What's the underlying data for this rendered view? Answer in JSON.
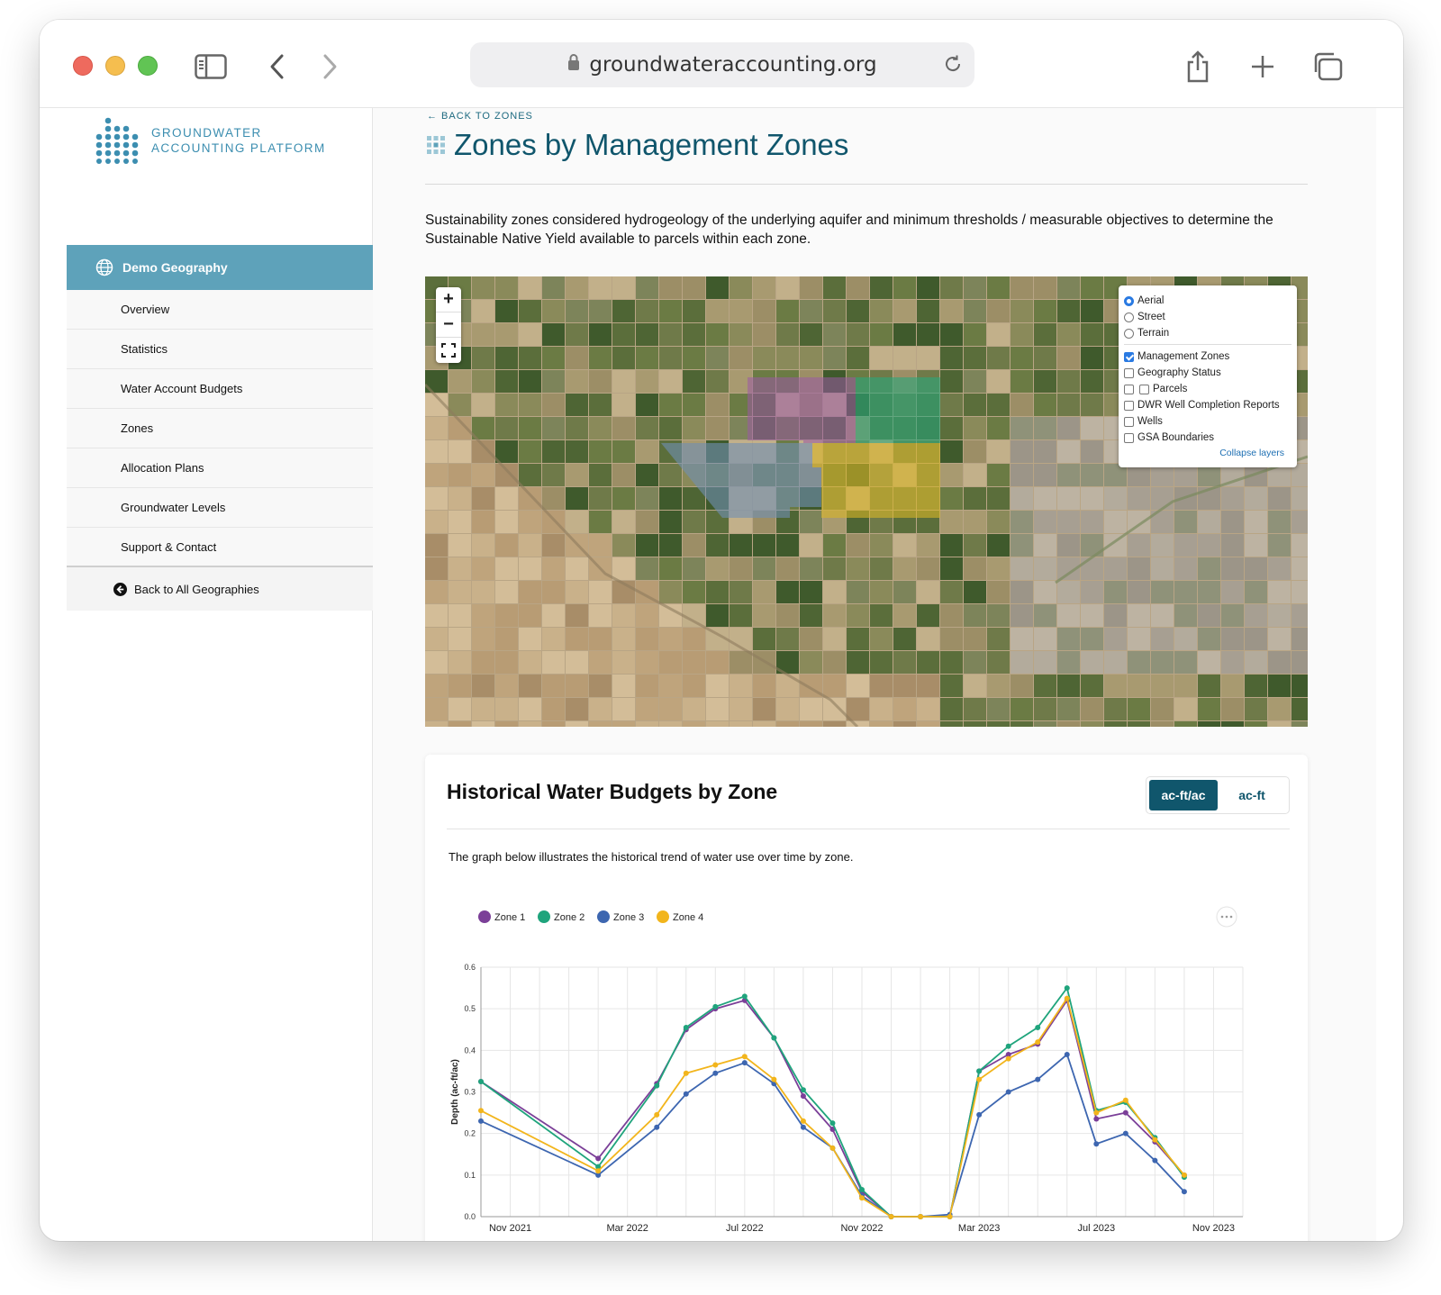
{
  "browser": {
    "url": "groundwateraccounting.org"
  },
  "sidebar": {
    "logo_line1": "GROUNDWATER",
    "logo_line2": "ACCOUNTING PLATFORM",
    "active_item": "Demo Geography",
    "items": [
      {
        "label": "Overview"
      },
      {
        "label": "Statistics"
      },
      {
        "label": "Water Account Budgets"
      },
      {
        "label": "Zones"
      },
      {
        "label": "Allocation Plans"
      },
      {
        "label": "Groundwater Levels"
      },
      {
        "label": "Support & Contact"
      }
    ],
    "back_label": "Back to All Geographies"
  },
  "main": {
    "back_link": "← BACK TO ZONES",
    "title": "Zones by Management Zones",
    "description": "Sustainability zones considered hydrogeology of the underlying aquifer and minimum thresholds / measurable objectives to determine the Sustainable Native Yield available to parcels within each zone."
  },
  "map": {
    "zoom_in": "+",
    "zoom_out": "−",
    "base_layers": [
      {
        "label": "Aerial",
        "selected": true
      },
      {
        "label": "Street",
        "selected": false
      },
      {
        "label": "Terrain",
        "selected": false
      }
    ],
    "overlays": [
      {
        "label": "Management Zones",
        "checked": true
      },
      {
        "label": "Geography Status",
        "checked": false
      },
      {
        "label": "Parcels",
        "checked": false
      },
      {
        "label": "DWR Well Completion Reports",
        "checked": false
      },
      {
        "label": "Wells",
        "checked": false
      },
      {
        "label": "GSA Boundaries",
        "checked": false
      }
    ],
    "collapse_label": "Collapse layers",
    "zone_colors": {
      "zone1": "#9a5aa6",
      "zone2": "#2aa77c",
      "zone3": "#6f8fb4",
      "zone4": "#d9b526"
    }
  },
  "budget_card": {
    "title": "Historical Water Budgets by Zone",
    "unit_active": "ac-ft/ac",
    "unit_other": "ac-ft",
    "description": "The graph below illustrates the historical trend of water use over time by zone."
  },
  "chart_data": {
    "type": "line",
    "ylabel": "Depth (ac-ft/ac)",
    "ylim": [
      0,
      0.6
    ],
    "yticks": [
      "0.0",
      "0.1",
      "0.2",
      "0.3",
      "0.4",
      "0.5",
      "0.6"
    ],
    "xticks": [
      "Nov 2021",
      "Mar 2022",
      "Jul 2022",
      "Nov 2022",
      "Mar 2023",
      "Jul 2023",
      "Nov 2023"
    ],
    "x": [
      "2021-10",
      "2021-11",
      "2021-12",
      "2022-01",
      "2022-02",
      "2022-03",
      "2022-04",
      "2022-05",
      "2022-06",
      "2022-07",
      "2022-08",
      "2022-09",
      "2022-10",
      "2022-11",
      "2022-12",
      "2023-01",
      "2023-02",
      "2023-03",
      "2023-04",
      "2023-05",
      "2023-06",
      "2023-07",
      "2023-08",
      "2023-09",
      "2023-10",
      "2023-11",
      "2023-12"
    ],
    "series": [
      {
        "name": "Zone 1",
        "color": "#7b3f98",
        "values": [
          0.325,
          null,
          null,
          null,
          0.14,
          null,
          0.32,
          0.45,
          0.5,
          0.52,
          0.43,
          0.29,
          0.21,
          0.06,
          0.0,
          0.0,
          0.0,
          0.35,
          0.39,
          0.415,
          0.52,
          0.235,
          0.25,
          0.18,
          0.1,
          null,
          null
        ]
      },
      {
        "name": "Zone 2",
        "color": "#1fa47c",
        "values": [
          0.325,
          null,
          null,
          null,
          0.12,
          null,
          0.315,
          0.455,
          0.505,
          0.53,
          0.43,
          0.305,
          0.225,
          0.065,
          0.0,
          0.0,
          0.0,
          0.35,
          0.41,
          0.455,
          0.55,
          0.255,
          0.275,
          0.19,
          0.095,
          null,
          null
        ]
      },
      {
        "name": "Zone 3",
        "color": "#3d66b0",
        "values": [
          0.23,
          null,
          null,
          null,
          0.1,
          null,
          0.215,
          0.295,
          0.345,
          0.37,
          0.32,
          0.215,
          0.165,
          0.05,
          0.0,
          0.0,
          0.005,
          0.245,
          0.3,
          0.33,
          0.39,
          0.175,
          0.2,
          0.135,
          0.06,
          null,
          null
        ]
      },
      {
        "name": "Zone 4",
        "color": "#f2b51c",
        "values": [
          0.255,
          null,
          null,
          null,
          0.11,
          null,
          0.245,
          0.345,
          0.365,
          0.385,
          0.33,
          0.23,
          0.165,
          0.045,
          0.0,
          0.0,
          0.0,
          0.33,
          0.38,
          0.42,
          0.525,
          0.25,
          0.28,
          0.185,
          0.1,
          null,
          null
        ]
      }
    ],
    "legend": "top-left",
    "grid": true
  }
}
